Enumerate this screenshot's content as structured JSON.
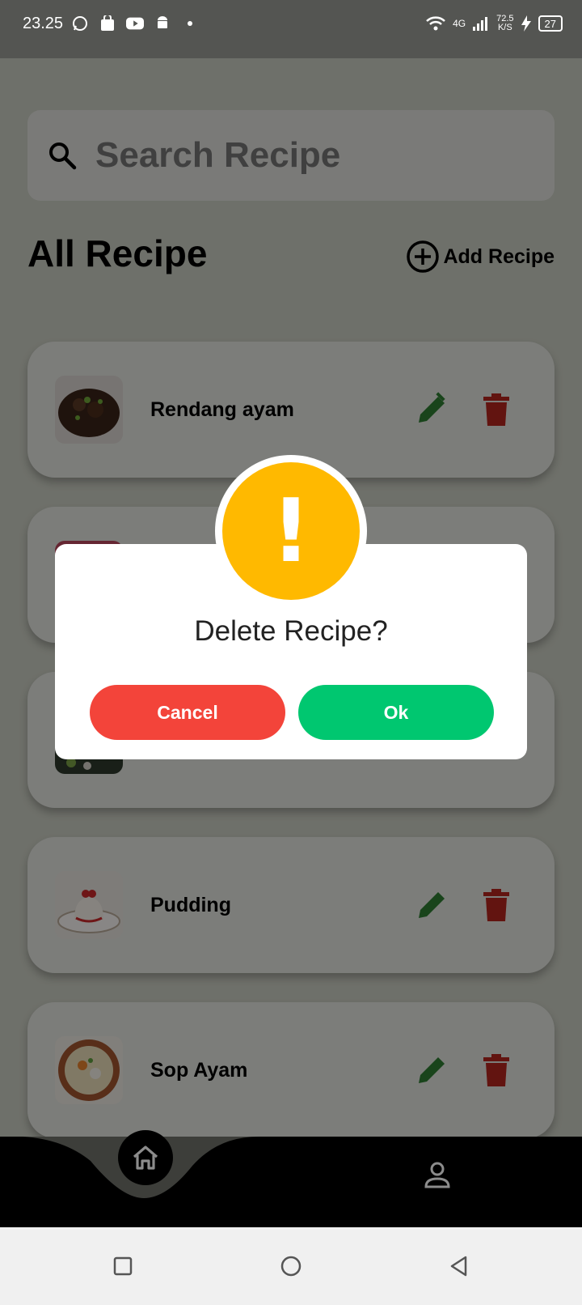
{
  "status_bar": {
    "time": "23.25",
    "network_type": "4G",
    "speed": "72.5",
    "speed_unit": "K/S",
    "battery": "27",
    "left_icons": [
      "whatsapp-icon",
      "shopping-bag-icon",
      "youtube-icon",
      "android-icon",
      "dot-icon"
    ]
  },
  "search": {
    "placeholder": "Search Recipe"
  },
  "header": {
    "title": "All Recipe",
    "add_label": "Add Recipe"
  },
  "recipes": [
    {
      "name": "Rendang ayam"
    },
    {
      "name": ""
    },
    {
      "name": ""
    },
    {
      "name": "Pudding"
    },
    {
      "name": "Sop Ayam"
    }
  ],
  "dialog": {
    "icon": "!",
    "title": "Delete Recipe?",
    "cancel_label": "Cancel",
    "ok_label": "Ok"
  },
  "colors": {
    "edit": "#2e7d32",
    "delete": "#b3261e",
    "cancel": "#f3443a",
    "ok": "#00c770",
    "warning": "#ffb900"
  }
}
